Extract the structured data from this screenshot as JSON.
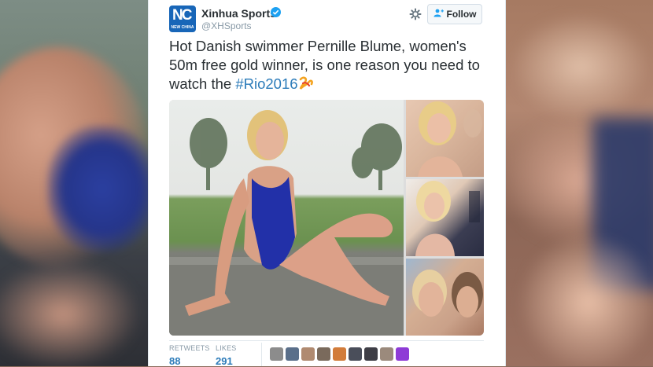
{
  "account": {
    "name": "Xinhua Sports",
    "handle": "@XHSports",
    "avatar_text": "NC",
    "avatar_subtext": "NEW CHINA"
  },
  "actions": {
    "follow_label": "Follow"
  },
  "tweet": {
    "text": "Hot Danish swimmer Pernille Blume, women's 50m free gold winner, is one reason you need to watch the ",
    "hashtag": "#Rio2016"
  },
  "stats": {
    "retweets_label": "RETWEETS",
    "retweets_count": "88",
    "likes_label": "LIKES",
    "likes_count": "291"
  },
  "likers": [
    {
      "color": "#8c8c8c"
    },
    {
      "color": "#5a6f8a"
    },
    {
      "color": "#b08a70"
    },
    {
      "color": "#7a6a5c"
    },
    {
      "color": "#d27c3a"
    },
    {
      "color": "#4a4e5a"
    },
    {
      "color": "#3e3e46"
    },
    {
      "color": "#9b8a7c"
    },
    {
      "color": "#8e3bd6"
    }
  ],
  "colors": {
    "accent": "#1da1f2",
    "link": "#2b7bb9",
    "text": "#292f33",
    "muted": "#8899a6"
  },
  "icons": {
    "gear": "gear-icon",
    "verified": "verified-badge-icon",
    "follow": "add-person-icon",
    "hashflag": "rio-hashflag-icon"
  }
}
